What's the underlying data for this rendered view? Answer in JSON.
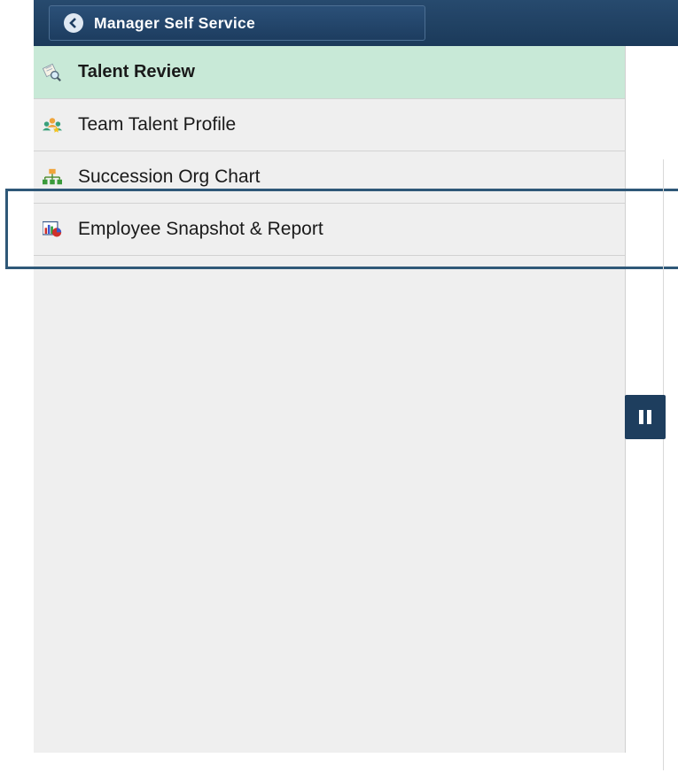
{
  "header": {
    "back_label": "Manager Self Service",
    "back_icon": "chevron-left-icon"
  },
  "sidebar": {
    "items": [
      {
        "label": "Talent Review",
        "icon": "magnifier-document-icon",
        "selected": true
      },
      {
        "label": "Team Talent Profile",
        "icon": "team-people-icon",
        "selected": false
      },
      {
        "label": "Succession Org Chart",
        "icon": "org-chart-icon",
        "selected": false
      },
      {
        "label": "Employee Snapshot & Report",
        "icon": "chart-report-icon",
        "selected": false
      }
    ]
  },
  "colors": {
    "header_bg": "#1b3a5a",
    "selected_bg": "#c8e9d7",
    "sidebar_bg": "#efefef",
    "highlight_border": "#2f5878"
  },
  "collapse_handle": {
    "icon": "pause-bars-icon"
  }
}
